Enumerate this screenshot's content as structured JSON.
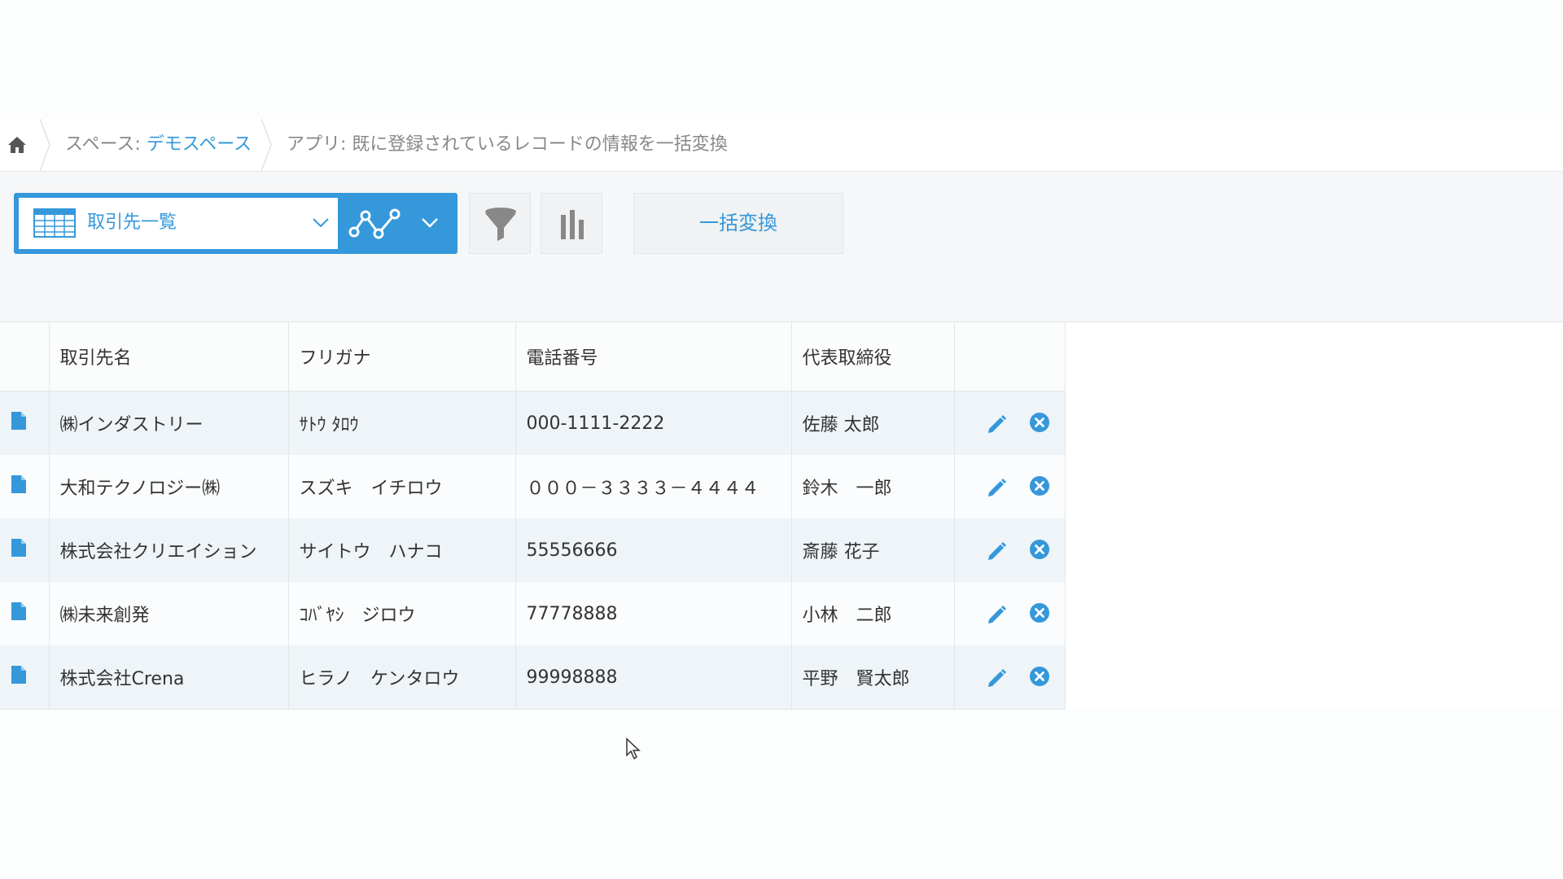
{
  "breadcrumb": {
    "space_prefix": "スペース: ",
    "space_name": "デモスペース",
    "app_label": "アプリ: 既に登録されているレコードの情報を一括変換"
  },
  "toolbar": {
    "view_name": "取引先一覧",
    "bulk_button_label": "一括変換"
  },
  "table": {
    "columns": [
      "取引先名",
      "フリガナ",
      "電話番号",
      "代表取締役"
    ],
    "rows": [
      [
        "㈱インダストリー",
        "ｻﾄｳ ﾀﾛｳ",
        "000-1111-2222",
        "佐藤 太郎"
      ],
      [
        "大和テクノロジー㈱",
        "スズキ　イチロウ",
        "０００－３３３３－４４４４",
        "鈴木　一郎"
      ],
      [
        "株式会社クリエイション",
        "サイトウ　ハナコ",
        "55556666",
        "斎藤 花子"
      ],
      [
        "㈱未来創発",
        "ｺﾊﾞﾔｼ　ジロウ",
        "77778888",
        "小林　二郎"
      ],
      [
        "株式会社Crena",
        "ヒラノ　ケンタロウ",
        "99998888",
        "平野　賢太郎"
      ]
    ]
  },
  "colors": {
    "accent": "#3498db",
    "delete": "#3498db",
    "row_alt": "#eef4f7"
  },
  "icons": [
    "home-icon",
    "list-view-icon",
    "chevron-down-icon",
    "graph-icon",
    "filter-icon",
    "bar-chart-icon",
    "document-icon",
    "edit-icon",
    "delete-icon"
  ]
}
